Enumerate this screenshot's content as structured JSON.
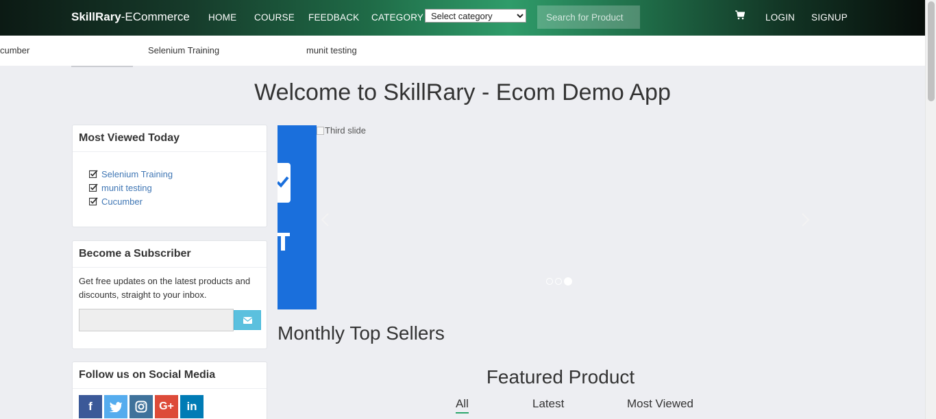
{
  "navbar": {
    "brand_bold": "SkillRary",
    "brand_rest": "-ECommerce",
    "links": [
      "HOME",
      "COURSE",
      "FEEDBACK",
      "CATEGORY"
    ],
    "category_select": "Select category",
    "search_placeholder": "Search for Product",
    "cart_icon": "shopping-cart-icon",
    "login": "LOGIN",
    "signup": "SIGNUP"
  },
  "ticker": {
    "items": [
      "cumber",
      "Selenium Training",
      "munit testing"
    ]
  },
  "page": {
    "title": "Welcome to SkillRary - Ecom Demo App"
  },
  "most_viewed": {
    "heading": "Most Viewed Today",
    "items": [
      "Selenium Training",
      "munit testing",
      "Cucumber"
    ]
  },
  "subscriber": {
    "heading": "Become a Subscriber",
    "text": "Get free updates on the latest products and discounts, straight to your inbox.",
    "button_icon": "envelope-icon"
  },
  "social": {
    "heading": "Follow us on Social Media",
    "icons": [
      "facebook-icon",
      "twitter-icon",
      "instagram-icon",
      "google-plus-icon",
      "linkedin-icon"
    ],
    "colors": [
      "#3b5998",
      "#55acee",
      "#3f729b",
      "#dd4b39",
      "#007bb5"
    ]
  },
  "carousel": {
    "slide_alt": "Third slide",
    "slide_count": 3,
    "active_index": 2
  },
  "sections": {
    "top_sellers": "Monthly Top Sellers",
    "featured": "Featured Product",
    "tabs": [
      "All",
      "Latest",
      "Most Viewed"
    ],
    "active_tab": "All"
  },
  "colors": {
    "accent": "#2aa66b",
    "link": "#3f76b4",
    "info_button": "#5bc0de"
  }
}
